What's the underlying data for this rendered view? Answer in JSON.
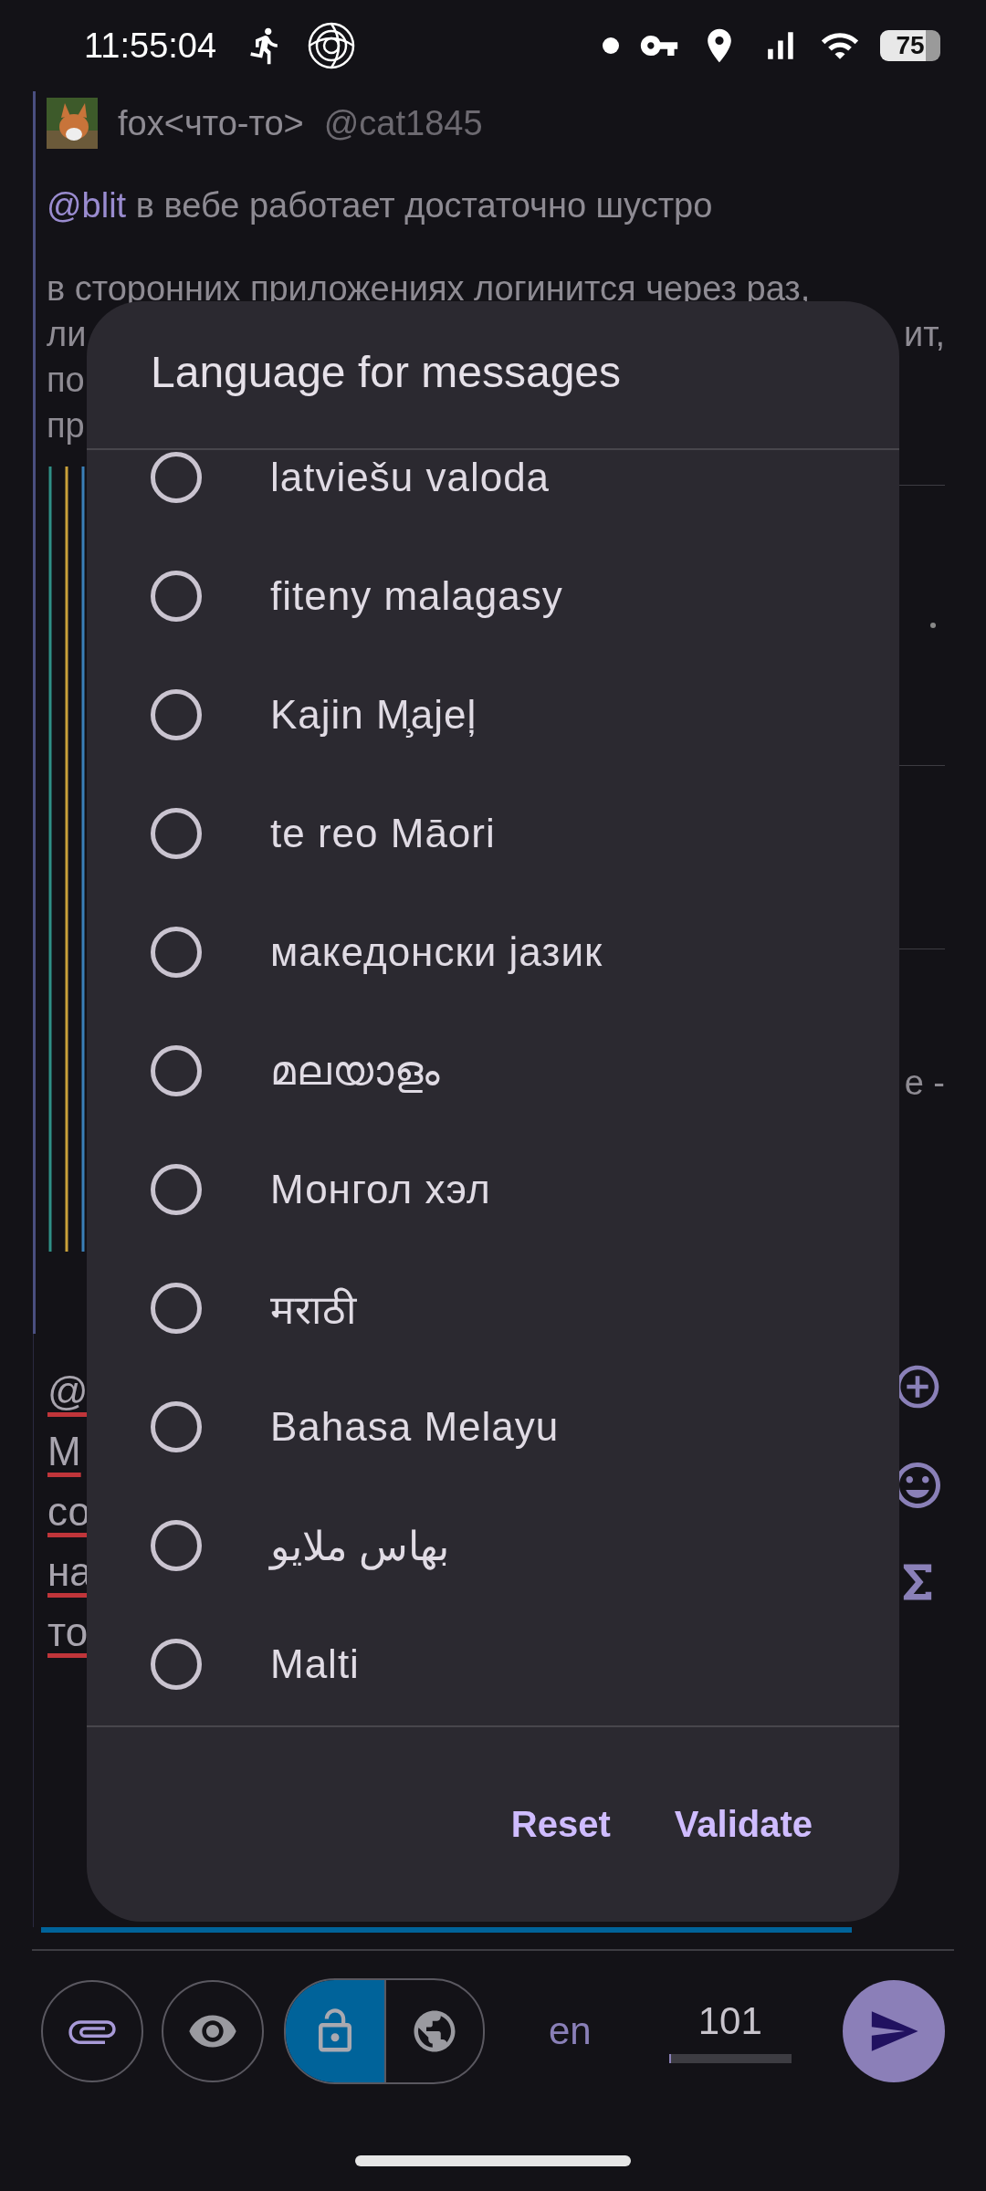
{
  "status_bar": {
    "time": "11:55:04",
    "battery": "75"
  },
  "thread": {
    "author": "fox<что-то>",
    "handle": "@cat1845",
    "mention": "@blit",
    "text": "в вебе работает достаточно шустро",
    "lines": [
      {
        "left": "в сторонних приложениях логинится через раз,"
      },
      {
        "left": "ли",
        "right": "ит,"
      },
      {
        "left": "по"
      },
      {
        "left": "пр"
      }
    ],
    "side_fragment": "е -"
  },
  "draft": {
    "fragments": [
      "@",
      "М",
      "со",
      "на",
      "то"
    ]
  },
  "dialog": {
    "title": "Language for messages",
    "options": [
      {
        "label": "latviešu valoda",
        "selected": false
      },
      {
        "label": "fiteny malagasy",
        "selected": false
      },
      {
        "label": "Kajin M̧ajeļ",
        "selected": false
      },
      {
        "label": "te reo Māori",
        "selected": false
      },
      {
        "label": "македонски јазик",
        "selected": false
      },
      {
        "label": "മലയാളം",
        "selected": false
      },
      {
        "label": "Монгол хэл",
        "selected": false
      },
      {
        "label": "मराठी",
        "selected": false
      },
      {
        "label": "Bahasa Melayu",
        "selected": false
      },
      {
        "label": "بهاس ملايو",
        "selected": false
      },
      {
        "label": "Malti",
        "selected": false
      }
    ],
    "buttons": [
      "Reset",
      "Validate"
    ]
  },
  "composer": {
    "visibility": [
      {
        "kind": "lock",
        "selected": true
      },
      {
        "kind": "globe",
        "selected": false
      }
    ],
    "language": "en",
    "counter": "101",
    "counter_meter": {
      "level": 0.02
    }
  }
}
